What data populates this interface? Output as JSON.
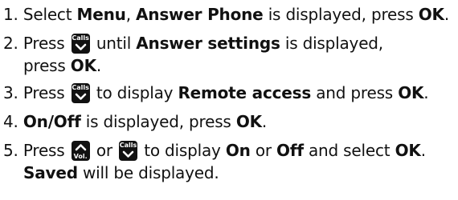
{
  "steps": [
    {
      "num": "1.",
      "t1": "Select ",
      "b1": "Menu",
      "t2": ", ",
      "b2": "Answer Phone",
      "t3": " is displayed, press ",
      "b3": "OK",
      "t4": "."
    },
    {
      "num": "2.",
      "t1": "Press ",
      "key": "Calls",
      "t2": " until ",
      "b1": "Answer settings",
      "t3": " is displayed,",
      "t4": "press ",
      "b2": "OK",
      "t5": "."
    },
    {
      "num": "3.",
      "t1": "Press ",
      "key": "Calls",
      "t2": " to display ",
      "b1": "Remote access",
      "t3": " and press ",
      "b2": "OK",
      "t4": "."
    },
    {
      "num": "4.",
      "b1": "On/Off",
      "t1": " is displayed, press ",
      "b2": "OK",
      "t2": "."
    },
    {
      "num": "5.",
      "t1": "Press ",
      "key1": "Vol.",
      "t2": " or ",
      "key2": "Calls",
      "t3": " to display ",
      "b1": "On",
      "t4": " or ",
      "b2": "Off",
      "t5": " and select ",
      "b3": "OK",
      "t6": ".",
      "b4": "Saved",
      "t7": " will be displayed."
    }
  ],
  "icons": {
    "calls_key": "chevron-down-icon",
    "vol_key": "chevron-up-icon"
  }
}
